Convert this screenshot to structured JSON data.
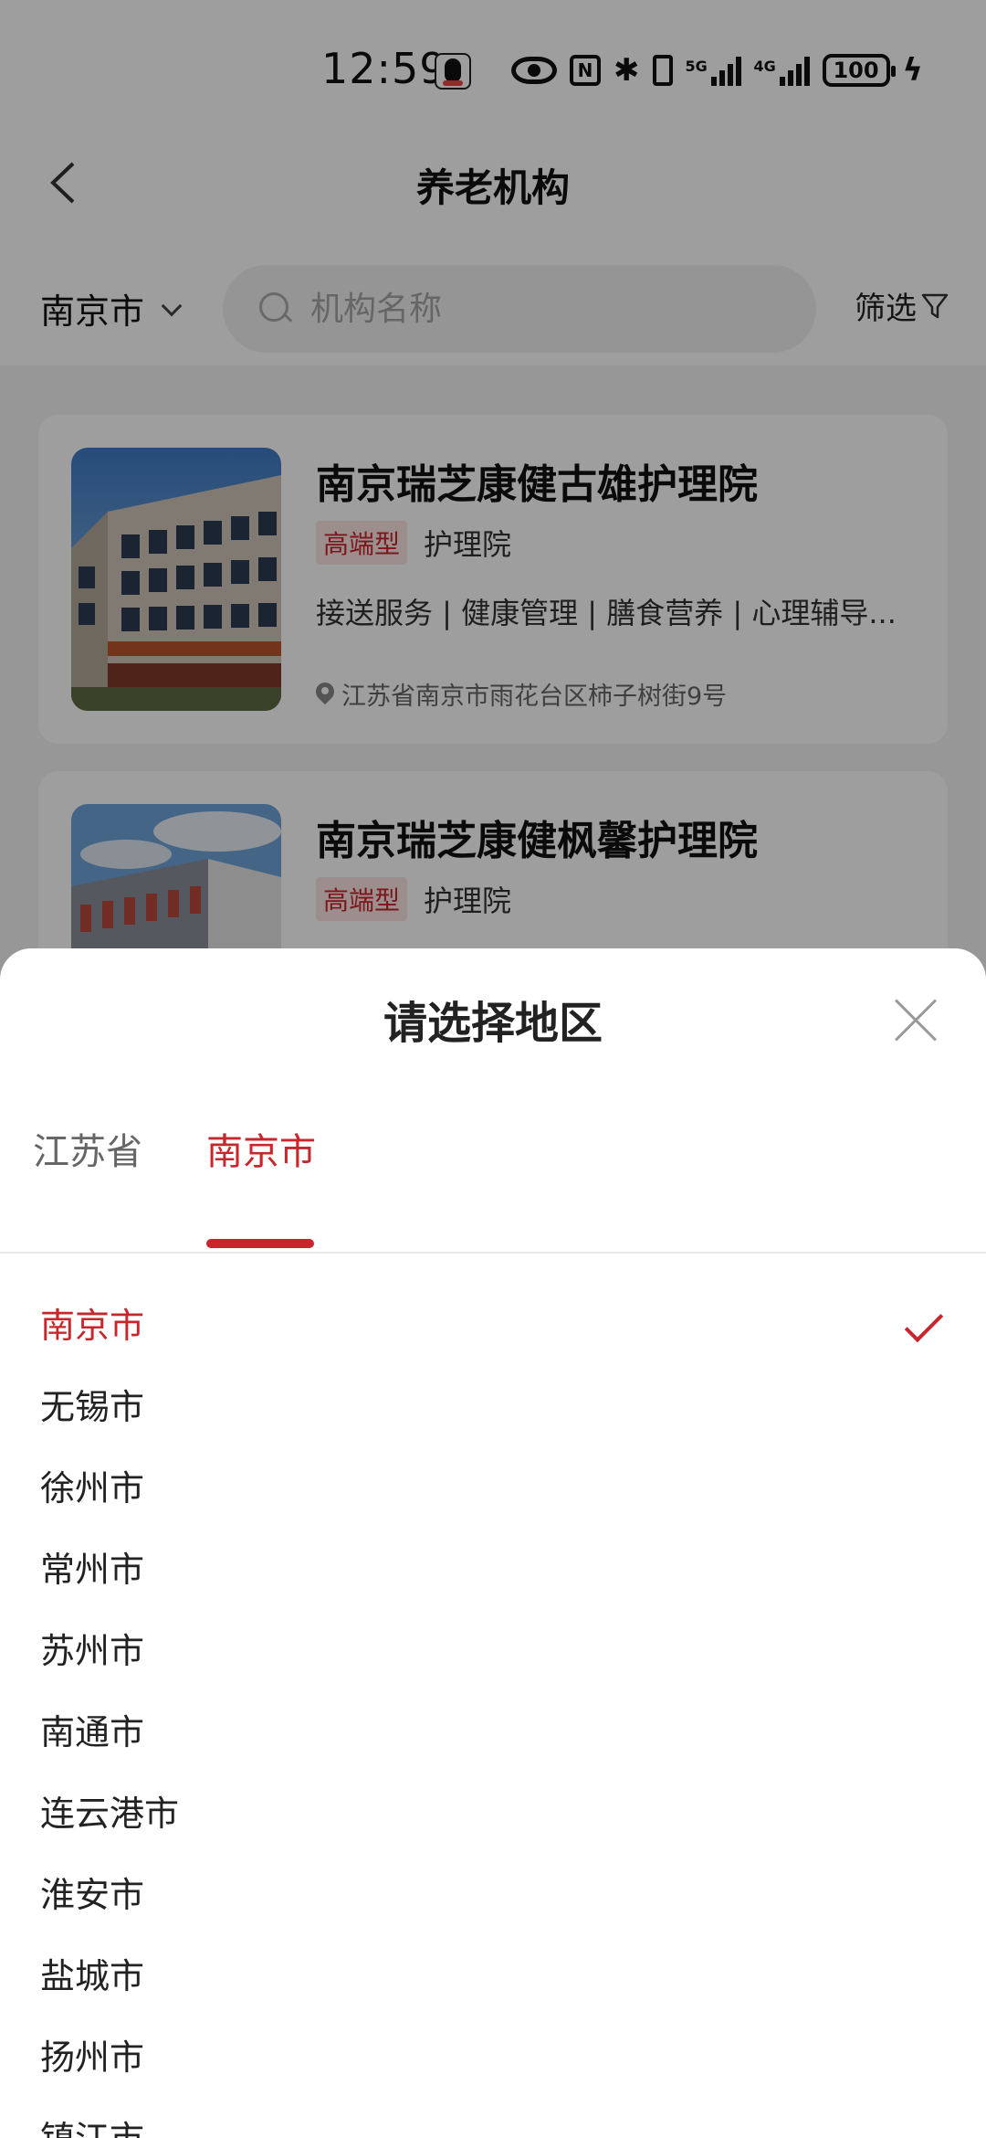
{
  "status_bar": {
    "time": "12:59",
    "battery": "100",
    "signal_1_label": "5G",
    "signal_2_label": "4G"
  },
  "nav": {
    "title": "养老机构",
    "city": "南京市",
    "search_placeholder": "机构名称",
    "filter_label": "筛选"
  },
  "institutions": [
    {
      "name": "南京瑞芝康健古雄护理院",
      "level": "高端型",
      "type": "护理院",
      "services": "接送服务 | 健康管理 | 膳食营养 | 心理辅导...",
      "address": "江苏省南京市雨花台区柿子树街9号"
    },
    {
      "name": "南京瑞芝康健枫馨护理院",
      "level": "高端型",
      "type": "护理院"
    }
  ],
  "region_sheet": {
    "title": "请选择地区",
    "tabs": [
      "江苏省",
      "南京市"
    ],
    "active_tab": "南京市",
    "selected": "南京市",
    "cities": [
      "南京市",
      "无锡市",
      "徐州市",
      "常州市",
      "苏州市",
      "南通市",
      "连云港市",
      "淮安市",
      "盐城市",
      "扬州市",
      "镇江市"
    ]
  },
  "colors": {
    "accent": "#c7262c",
    "tag_bg": "#fde6e6"
  }
}
